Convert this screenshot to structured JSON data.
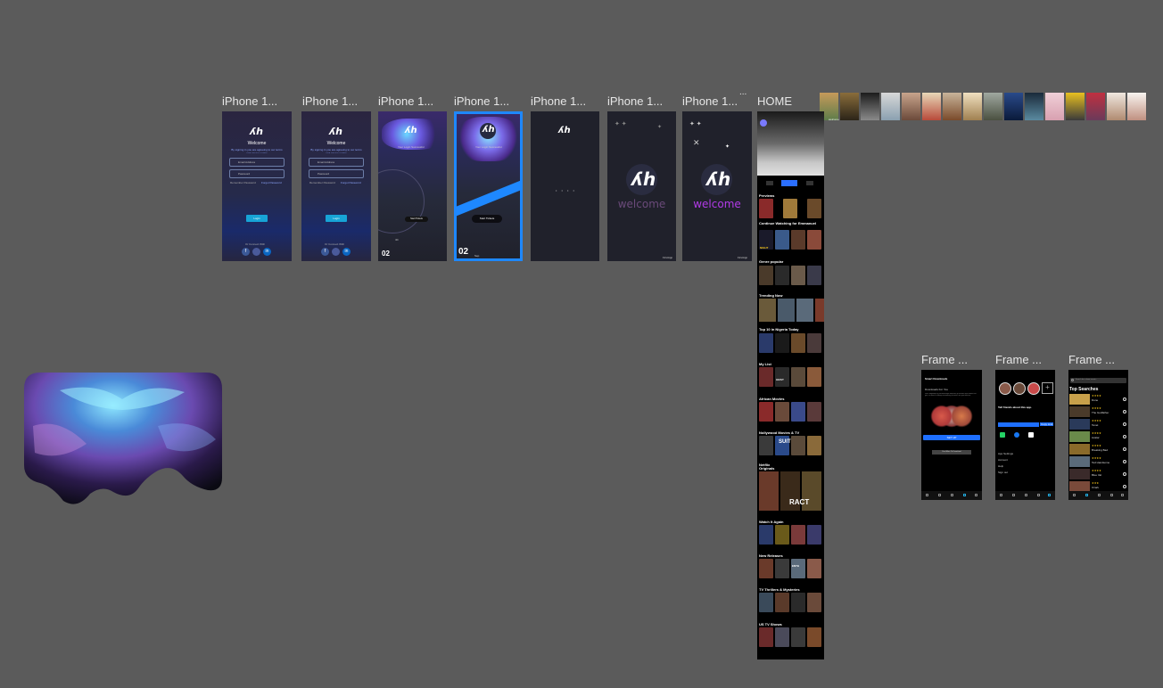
{
  "canvas": {
    "background": "#5b5b5b",
    "frame_background": "#20212b",
    "selection_color": "#1e88ff",
    "accent": "#17a4d6",
    "brand_purple": "#b23be8"
  },
  "labels": {
    "iphone1": "iPhone 1...",
    "iphone2": "iPhone 1...",
    "iphone3": "iPhone 1...",
    "iphone4": "iPhone 1...",
    "iphone5": "iPhone 1...",
    "iphone6": "iPhone 1...",
    "iphone7": "iPhone 1...",
    "home": "HOME",
    "frame1": "Frame ...",
    "frame2": "Frame ...",
    "frame3": "Frame ...",
    "overflow": "...",
    "side_text": "welcome"
  },
  "login": {
    "logo": "ʎh",
    "title": "Welcome",
    "subtitle": "By signing in you are agreeing to our terms and privacy policy",
    "email_placeholder": "Email Address",
    "password_placeholder": "Password",
    "remember": "Remember Password",
    "forgot": "Forgot Password",
    "button": "Login",
    "or_connect": "Or Connect With"
  },
  "splash": {
    "login_success": "Your Login Successful",
    "start_button": "Start Tickets",
    "date_big": "02",
    "date_small": "Sep",
    "brand_small": "4C",
    "welcome": "welcome",
    "loading": "• • • •",
    "credit": "FirstApp"
  },
  "home": {
    "sections": [
      "Previews",
      "Continue Watching for Emmanuel",
      "Genre popular",
      "Trending Now",
      "Top 10 in Nigeria Today",
      "My List",
      "African Movies",
      "Nollywood Movies & TV",
      "Netflix Originals",
      "Watch It Again",
      "New Releases",
      "TV Thrillers & Mysteries",
      "US TV Shows"
    ],
    "poster_titles": [
      "NIGHT",
      "SUIT",
      "RACT",
      "NETFL",
      "HEIST",
      "ENTH"
    ]
  },
  "frames": {
    "downloads": {
      "title": "Smart Downloads",
      "heading": "Downloads For You",
      "description": "We'll download a personalized selection of movies and shows for you, so there's always something to watch on your device.",
      "setup": "SET UP",
      "find_more": "Find More To Download"
    },
    "more": {
      "tell_friends": "Tell friends about this app.",
      "copy_link": "Copy Link",
      "menu": [
        "App Settings",
        "Account",
        "Help",
        "Sign out"
      ]
    },
    "search": {
      "placeholder": "Search for a show, movie...",
      "heading": "Top Searches",
      "items": [
        "Dune",
        "The Godfather",
        "Tenet",
        "Avatar",
        "Breaking Bad",
        "Ted Handsome",
        "Blue Val",
        "Ozark"
      ]
    }
  },
  "icons": [
    "search-icon",
    "play-icon",
    "home-icon",
    "download-icon",
    "facebook-icon",
    "google-icon",
    "linkedin-icon",
    "star-icon"
  ]
}
